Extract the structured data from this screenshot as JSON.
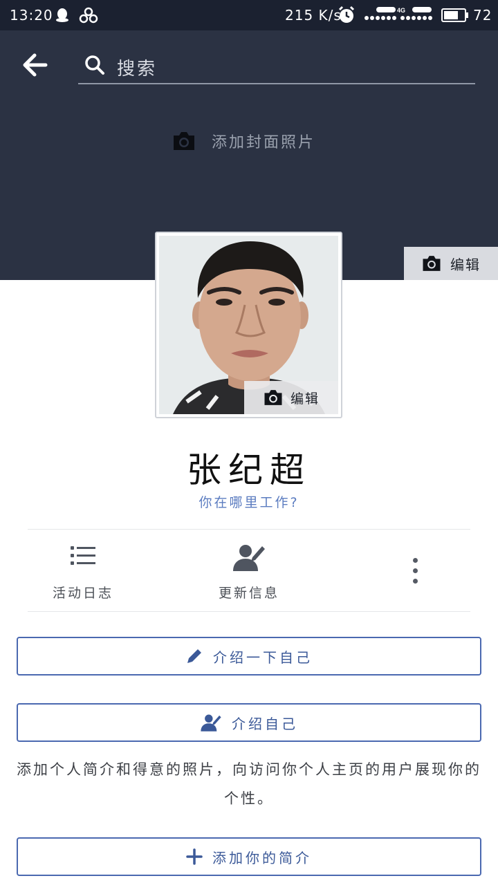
{
  "status_bar": {
    "time": "13:20",
    "speed": "215 K/s",
    "network": "4G",
    "signal_label": "SIGNAL",
    "battery_percent": "72",
    "icons": [
      "qq-icon",
      "cloud-sync-icon",
      "alarm-icon",
      "signal-icon",
      "battery-icon"
    ]
  },
  "search": {
    "placeholder": "搜索"
  },
  "cover": {
    "add_cover_label": "添加封面照片",
    "edit_label": "编辑"
  },
  "avatar": {
    "edit_label": "编辑"
  },
  "profile": {
    "name": "张纪超",
    "work_prompt": "你在哪里工作?"
  },
  "actions": {
    "activity_log": "活动日志",
    "update_info": "更新信息"
  },
  "buttons": {
    "describe_yourself": "介绍一下自己",
    "introduce_yourself": "介绍自己",
    "add_bio": "添加你的简介"
  },
  "intro_text": "添加个人简介和得意的照片，向访问你个人主页的用户展现你的个性。",
  "colors": {
    "cover_bg": "#2b3243",
    "status_bg": "#1b2130",
    "accent": "#3b5998",
    "link": "#5b7cc0"
  }
}
